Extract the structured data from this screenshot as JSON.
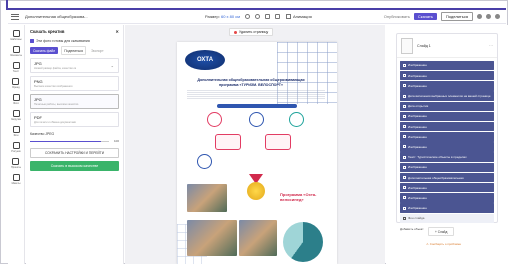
{
  "topbar": {
    "doc_title": "Дополнительная общеобразова...",
    "resize_label": "Размер:",
    "resize_value": "60 x 80 см",
    "animation_label": "Анимация",
    "btn_preview": "Опубликовать",
    "btn_download": "Скачать",
    "btn_share": "Поделиться"
  },
  "sidebar": {
    "items": [
      {
        "label": "Шаблоны",
        "icon": "template-icon"
      },
      {
        "label": "Элементы",
        "icon": "elements-icon"
      },
      {
        "label": "Текст",
        "icon": "text-icon"
      },
      {
        "label": "Бренд",
        "icon": "brand-icon"
      },
      {
        "label": "Фото",
        "icon": "photo-icon"
      },
      {
        "label": "Загрузки",
        "icon": "upload-icon"
      },
      {
        "label": "Фон",
        "icon": "background-icon"
      },
      {
        "label": "Рисунок",
        "icon": "draw-icon"
      },
      {
        "label": "Проекты",
        "icon": "projects-icon"
      },
      {
        "label": "Макеты",
        "icon": "mockup-icon"
      }
    ]
  },
  "download_panel": {
    "title": "Скачать креатив",
    "checkbox_label": "Эти фото готовы для скачивания",
    "tabs": [
      "Скачать файл",
      "Поделиться",
      "Экспорт"
    ],
    "formats": [
      {
        "name": "JPG",
        "desc": "Низкий размер файла, качество ок"
      },
      {
        "name": "PNG",
        "desc": "Высокое качество изображения"
      },
      {
        "name": "JPG",
        "desc": "Печатные работы, высокое качество"
      },
      {
        "name": "PDF",
        "desc": "Для печати и обмена документами"
      }
    ],
    "quality_label": "Качество JPEG",
    "quality_value": "100",
    "quality_fraction": 0.9,
    "save_button": "СОХРАНИТЬ НАСТРОЙКИ И ПЕРЕЙТИ",
    "download_button": "Скачать в высоком качестве"
  },
  "canvas": {
    "page_button": "Удалить страницу",
    "poster": {
      "logo_text": "ОХТА",
      "title": "Дополнительная общеобразовательная общеразвивающая программа «ТУРИЗМ. ВЕЛОСПОРТ»",
      "badge": "Программа «Охта-велосипед»"
    }
  },
  "layers": {
    "page_name": "Слайд 1",
    "rows": [
      "Изображение",
      "Изображение",
      "Изображение",
      "Дата включения выбранных элементов на вашей странице",
      "Дата открытия",
      "Изображение",
      "Изображение",
      "Изображение",
      "Изображение",
      "Текст: Туристические объекты в пределах",
      "Изображение",
      "Дополнительная общеобразовательная",
      "Изображение",
      "Изображение",
      "Изображение",
      "Фон слайда"
    ],
    "add_label": "Добавить объект",
    "more_button": "+ Слайд",
    "report_link": "Сообщить о проблеме"
  }
}
